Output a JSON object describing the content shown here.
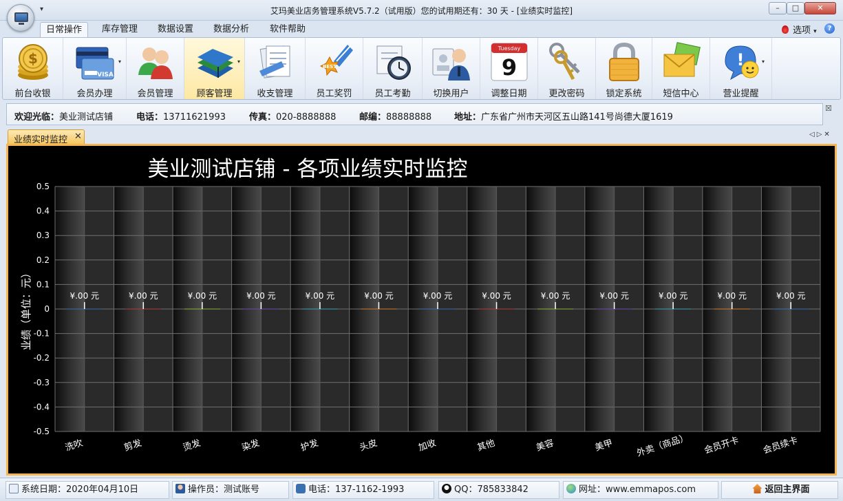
{
  "window": {
    "title": "艾玛美业店务管理系统V5.7.2（试用版）您的试用期还有：30 天 - [业绩实时监控]",
    "min": "–",
    "max": "□",
    "close": "✕"
  },
  "qat_arrow": "▾",
  "ribbon_tabs": [
    "日常操作",
    "库存管理",
    "数据设置",
    "数据分析",
    "软件帮助"
  ],
  "options_label": "选项",
  "ribbon_buttons": [
    {
      "label": "前台收银",
      "icon": "coins-icon"
    },
    {
      "label": "会员办理",
      "icon": "member-card-icon"
    },
    {
      "label": "会员管理",
      "icon": "users-icon"
    },
    {
      "label": "顾客管理",
      "icon": "books-icon"
    },
    {
      "label": "收支管理",
      "icon": "documents-icon"
    },
    {
      "label": "员工奖罚",
      "icon": "award-badge-icon"
    },
    {
      "label": "员工考勤",
      "icon": "clock-icon"
    },
    {
      "label": "切换用户",
      "icon": "switch-user-icon"
    },
    {
      "label": "调整日期",
      "icon": "calendar-icon"
    },
    {
      "label": "更改密码",
      "icon": "keys-icon"
    },
    {
      "label": "锁定系统",
      "icon": "padlock-icon"
    },
    {
      "label": "短信中心",
      "icon": "envelope-icon"
    },
    {
      "label": "营业提醒",
      "icon": "smiley-alert-icon"
    }
  ],
  "calendar": {
    "weekday": "Tuesday",
    "day": "9"
  },
  "info": {
    "welcome_label": "欢迎光临：",
    "welcome_value": "美业测试店铺",
    "phone_label": "电话：",
    "phone_value": "13711621993",
    "fax_label": "传真：",
    "fax_value": "020-8888888",
    "zip_label": "邮编：",
    "zip_value": "88888888",
    "addr_label": "地址：",
    "addr_value": "广东省广州市天河区五山路141号尚德大厦1619"
  },
  "doc_tab": {
    "label": "业绩实时监控",
    "close": "✕"
  },
  "chart_data": {
    "type": "bar",
    "title": "美业测试店铺 - 各项业绩实时监控",
    "ylabel": "业绩（单位：元）",
    "xlabel": "",
    "categories": [
      "洗吹",
      "剪发",
      "烫发",
      "染发",
      "护发",
      "头皮",
      "加收",
      "其他",
      "美容",
      "美甲",
      "外卖（商品）",
      "会员开卡",
      "会员续卡"
    ],
    "values": [
      0,
      0,
      0,
      0,
      0,
      0,
      0,
      0,
      0,
      0,
      0,
      0,
      0
    ],
    "data_labels": [
      "¥.00 元",
      "¥.00 元",
      "¥.00 元",
      "¥.00 元",
      "¥.00 元",
      "¥.00 元",
      "¥.00 元",
      "¥.00 元",
      "¥.00 元",
      "¥.00 元",
      "¥.00 元",
      "¥.00 元",
      "¥.00 元"
    ],
    "bar_colors": [
      "#3a6fb0",
      "#b03a3a",
      "#8fb03a",
      "#6a4ab0",
      "#3aa0b0",
      "#d07a2a",
      "#3a6fb0",
      "#b03a3a",
      "#8fb03a",
      "#6a4ab0",
      "#3aa0b0",
      "#d07a2a",
      "#3a6fb0"
    ],
    "yticks": [
      "0.5",
      "0.4",
      "0.3",
      "0.2",
      "0.1",
      "0",
      "-0.1",
      "-0.2",
      "-0.3",
      "-0.4",
      "-0.5"
    ],
    "ylim": [
      -0.5,
      0.5
    ],
    "grid": true
  },
  "status": {
    "date_label": "系统日期：",
    "date_value": "2020年04月10日",
    "operator_label": "操作员：",
    "operator_value": "测试账号",
    "phone_label": "电话：",
    "phone_value": "137-1162-1993",
    "qq_label": "QQ：",
    "qq_value": "785833842",
    "site_label": "网址：",
    "site_value": "www.emmapos.com",
    "home_label": "返回主界面"
  }
}
